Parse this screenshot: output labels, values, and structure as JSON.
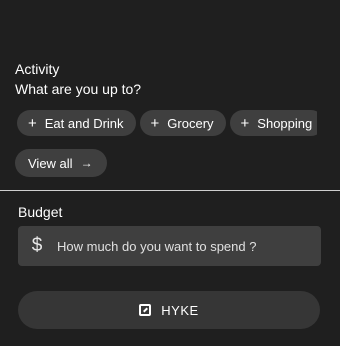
{
  "activity": {
    "title": "Activity",
    "subtitle": "What are you up to?",
    "chips": [
      {
        "icon": "plus-icon",
        "plus": "+",
        "label": "Eat and Drink"
      },
      {
        "icon": "plus-icon",
        "plus": "+",
        "label": "Grocery"
      },
      {
        "icon": "plus-icon",
        "plus": "+",
        "label": "Shopping"
      }
    ],
    "view_all": {
      "label": "View all",
      "icon": "arrow-right-icon",
      "arrow": "→"
    }
  },
  "budget": {
    "title": "Budget",
    "currency_icon": "dollar-icon",
    "currency_symbol": "$",
    "placeholder": "How much do you want to spend ?"
  },
  "submit": {
    "icon": "hyke-logo-icon",
    "label": "HYKE"
  },
  "colors": {
    "background": "#1f1f1f",
    "chip": "#3f3f3f",
    "divider": "#cfcfcf",
    "button": "#363636"
  }
}
